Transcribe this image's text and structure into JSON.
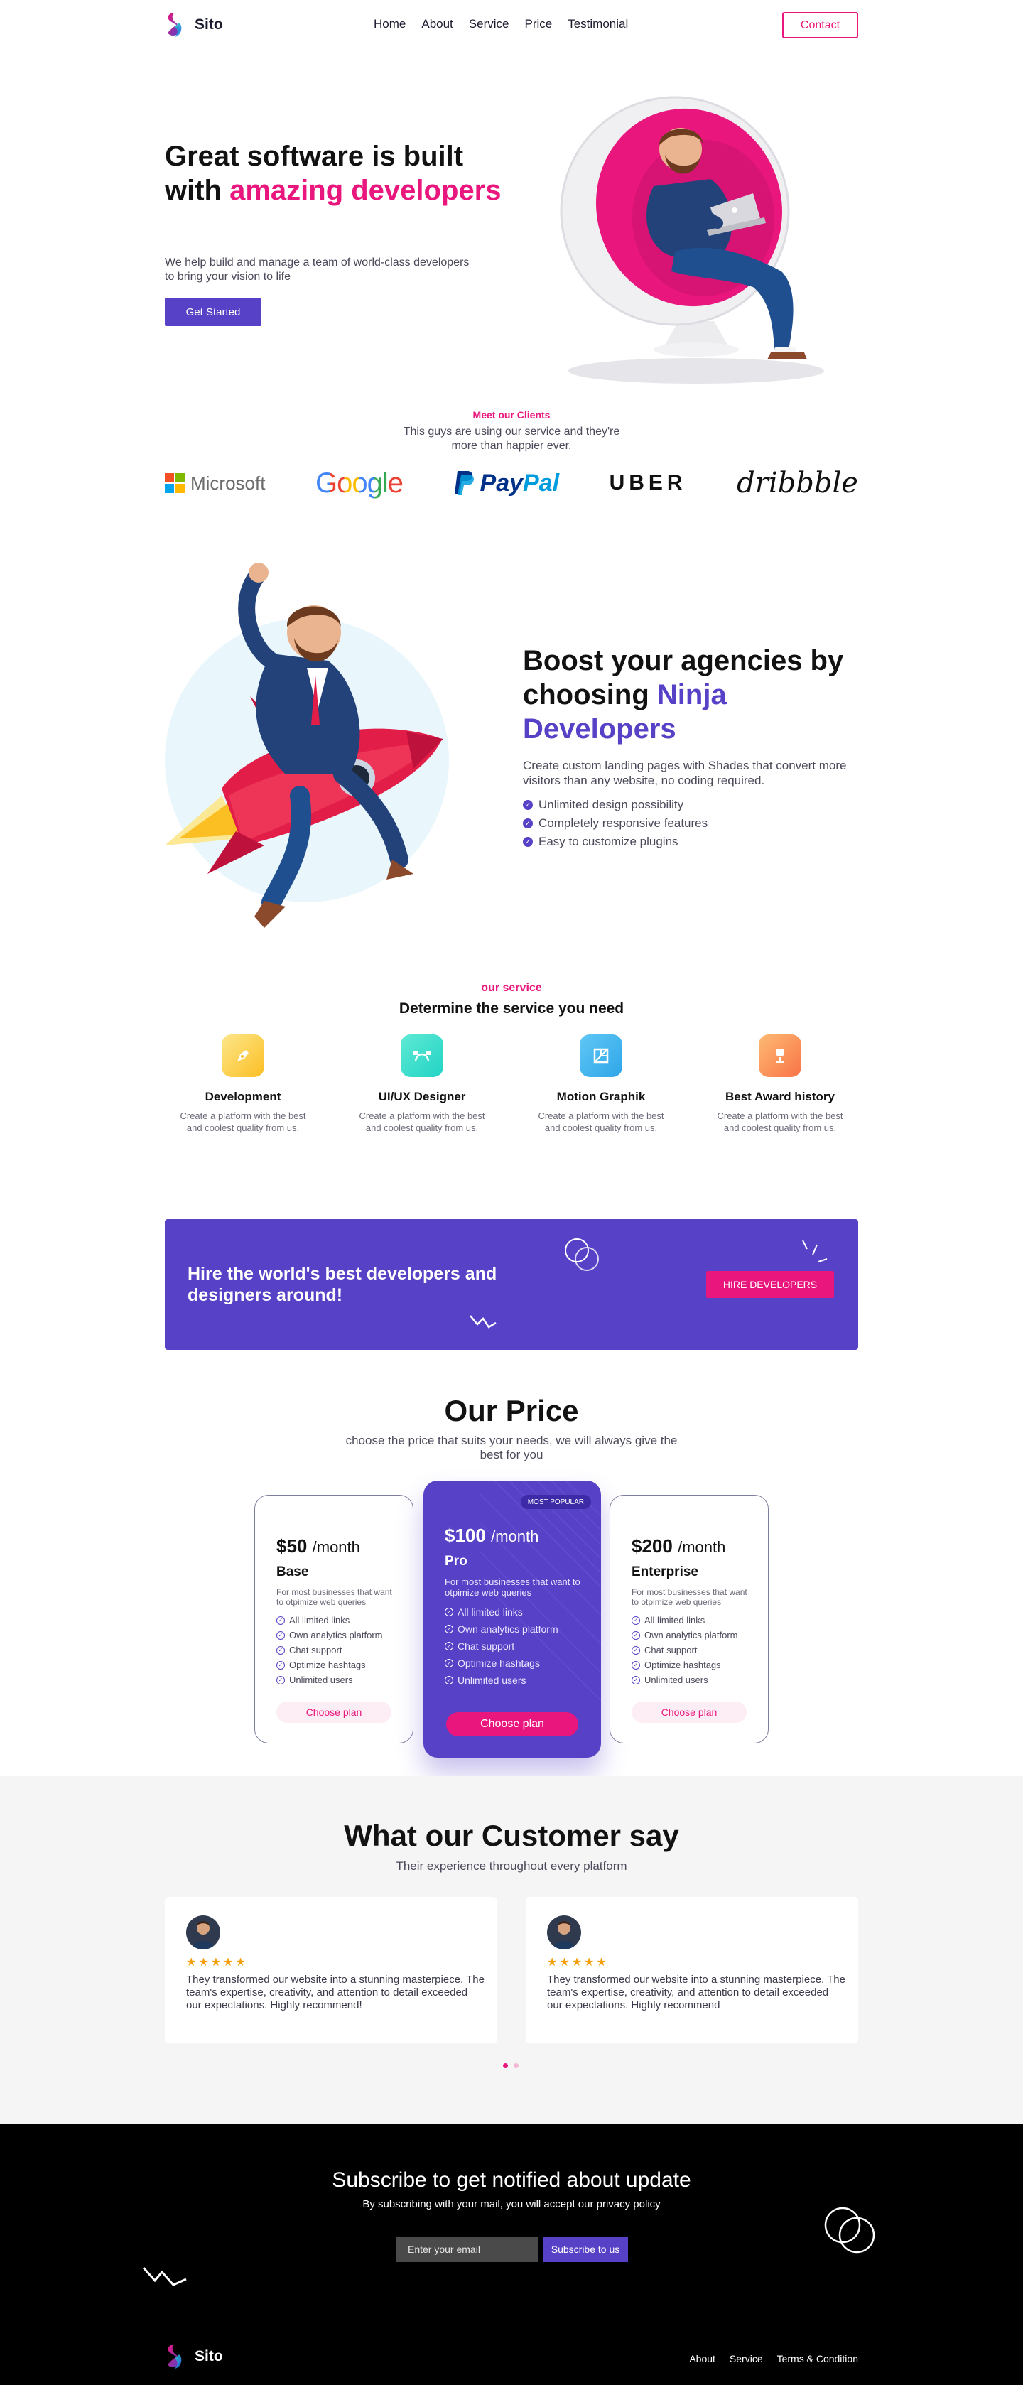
{
  "brand": {
    "name": "Sito"
  },
  "nav": {
    "items": [
      {
        "label": "Home"
      },
      {
        "label": "About"
      },
      {
        "label": "Service"
      },
      {
        "label": "Price"
      },
      {
        "label": "Testimonial"
      }
    ],
    "contact_label": "Contact"
  },
  "hero": {
    "title_line1": "Great software is built",
    "title_with": "with ",
    "title_accent": "amazing developers",
    "subtitle": "We help build and manage a team of world-class developers to bring your vision to life",
    "cta_label": "Get Started"
  },
  "clients": {
    "label": "Meet our Clients",
    "subtitle": "This guys are using our service and they're more than happier ever.",
    "logos": [
      "Microsoft",
      "Google",
      "PayPal",
      "UBER",
      "dribbble"
    ]
  },
  "boost": {
    "title_plain": "Boost your agencies by choosing ",
    "title_accent": "Ninja Developers",
    "description": "Create custom landing pages with Shades that convert more visitors than any website, no coding required.",
    "features": [
      "Unlimited design possibility",
      "Completely responsive features",
      "Easy to customize plugins"
    ]
  },
  "service": {
    "label": "our service",
    "title": "Determine the service you need",
    "items": [
      {
        "title": "Development",
        "desc": "Create a platform with the best and coolest quality from us.",
        "icon": "pen-icon",
        "color": "#fbbf24"
      },
      {
        "title": "UI/UX Designer",
        "desc": "Create a platform with the best and coolest quality from us.",
        "icon": "bezier-icon",
        "color": "#22d3c5"
      },
      {
        "title": "Motion Graphik",
        "desc": "Create a platform with the best and coolest quality from us.",
        "icon": "motion-icon",
        "color": "#2ea6e8"
      },
      {
        "title": "Best Award history",
        "desc": "Create a platform with the best and coolest quality from us.",
        "icon": "trophy-icon",
        "color": "#f97346"
      }
    ]
  },
  "hire": {
    "text": "Hire the world's best developers and designers around!",
    "cta_label": "HIRE DEVELOPERS"
  },
  "pricing": {
    "title": "Our Price",
    "subtitle": "choose the price that suits your needs, we will always give the best for you",
    "plans": [
      {
        "price": "$50",
        "period": "/month",
        "name": "Base",
        "desc": "For most businesses that want to otpimize web queries",
        "features": [
          "All limited links",
          "Own analytics platform",
          "Chat support",
          "Optimize hashtags",
          "Unlimited users"
        ],
        "cta": "Choose plan"
      },
      {
        "price": "$100",
        "period": "/month",
        "name": "Pro",
        "desc": "For most businesses that want to otpimize web queries",
        "features": [
          "All limited links",
          "Own analytics platform",
          "Chat support",
          "Optimize hashtags",
          "Unlimited users"
        ],
        "cta": "Choose plan",
        "badge": "MOST POPULAR"
      },
      {
        "price": "$200",
        "period": "/month",
        "name": "Enterprise",
        "desc": "For most businesses that want to otpimize web queries",
        "features": [
          "All limited links",
          "Own analytics platform",
          "Chat support",
          "Optimize hashtags",
          "Unlimited users"
        ],
        "cta": "Choose plan"
      }
    ]
  },
  "testimonials": {
    "title": "What our Customer say",
    "subtitle": "Their experience throughout every platform",
    "items": [
      {
        "stars": "★★★★★",
        "rating": 4.5,
        "quote": "They transformed our website into a stunning masterpiece. The team's expertise, creativity, and attention to detail exceeded our expectations. Highly recommend!"
      },
      {
        "stars": "★★★★★",
        "rating": 4.5,
        "quote": "They transformed our website into a stunning masterpiece. The team's expertise, creativity, and attention to detail exceeded our expectations. Highly recommend"
      }
    ]
  },
  "subscribe": {
    "title": "Subscribe to get notified about update",
    "desc": "By subscribing with your mail, you will accept our privacy policy",
    "placeholder": "Enter your email",
    "cta_label": "Subscribe to us"
  },
  "footer": {
    "links": [
      {
        "label": "About"
      },
      {
        "label": "Service"
      },
      {
        "label": "Terms & Condition"
      }
    ]
  },
  "colors": {
    "accent_pink": "#e8167d",
    "accent_purple": "#5741c6",
    "footer_bg": "#000000",
    "testimonial_bg": "#f5f5f6"
  }
}
